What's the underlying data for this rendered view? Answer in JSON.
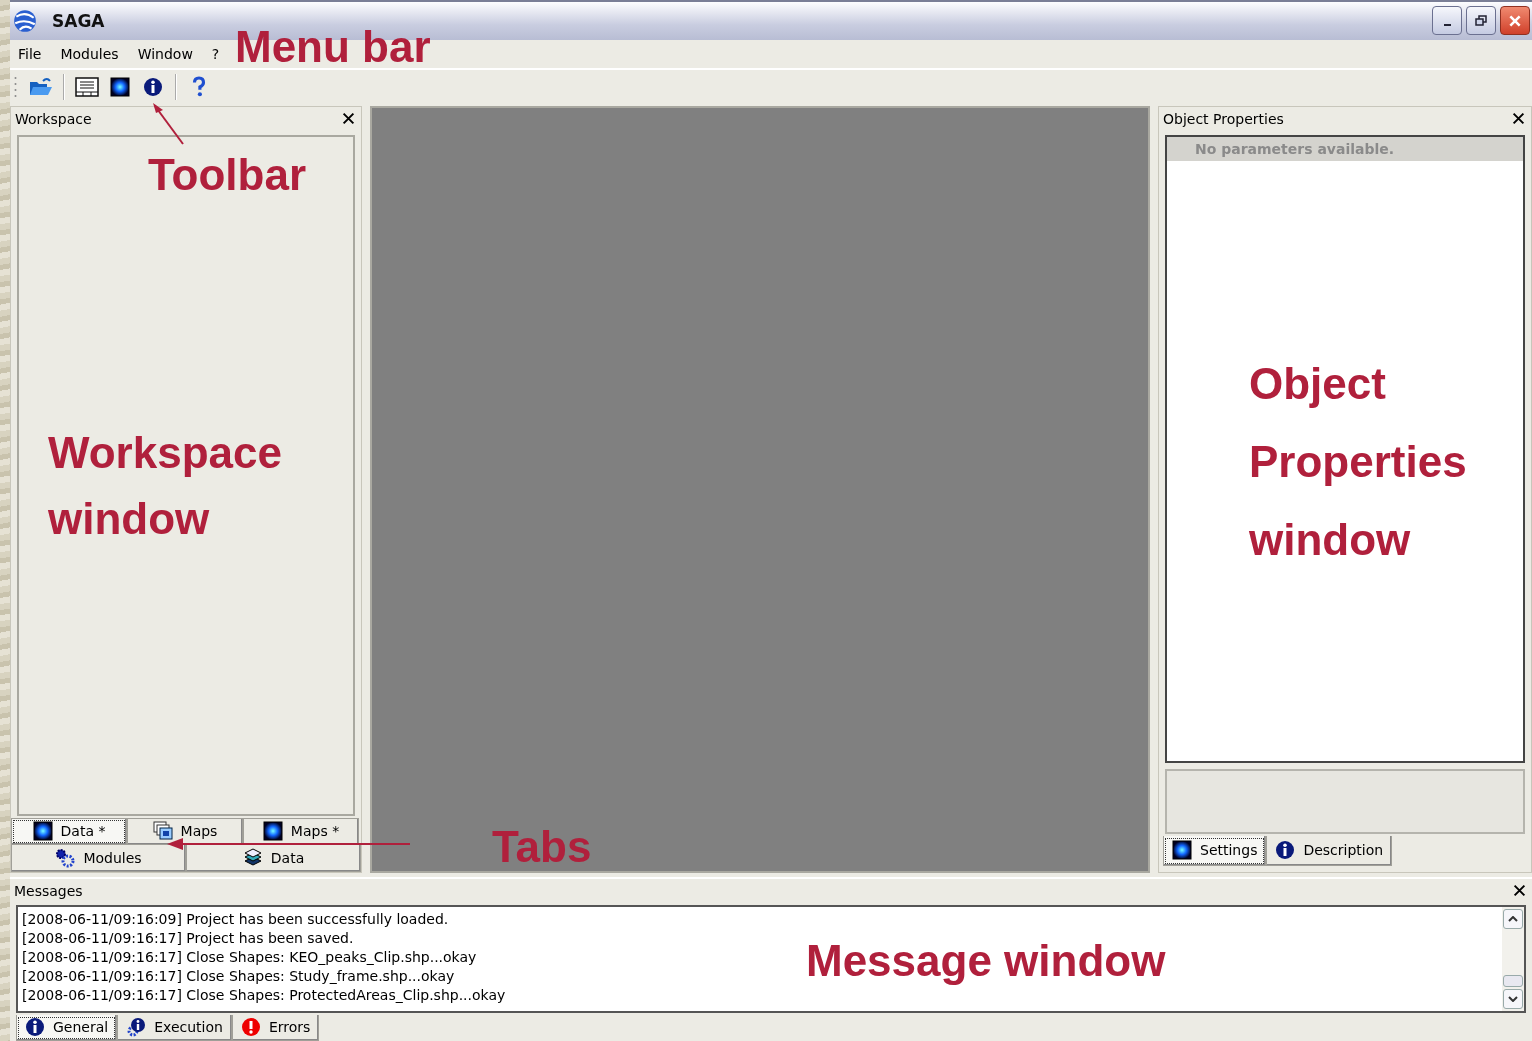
{
  "window": {
    "title": "SAGA"
  },
  "menu": [
    "File",
    "Modules",
    "Window",
    "?"
  ],
  "workspace": {
    "title": "Workspace",
    "tabs_row1": [
      {
        "label": "Data *",
        "kind": "grid",
        "selected": true
      },
      {
        "label": "Maps",
        "kind": "maps",
        "selected": false
      },
      {
        "label": "Maps *",
        "kind": "grid",
        "selected": false
      }
    ],
    "tabs_row2": [
      {
        "label": "Modules",
        "kind": "modules",
        "selected": false
      },
      {
        "label": "Data",
        "kind": "layers",
        "selected": false
      }
    ]
  },
  "object_properties": {
    "title": "Object Properties",
    "notice": "No parameters available.",
    "tabs": [
      {
        "label": "Settings",
        "kind": "grid",
        "selected": true
      },
      {
        "label": "Description",
        "kind": "info",
        "selected": false
      }
    ]
  },
  "messages": {
    "title": "Messages",
    "lines": [
      "[2008-06-11/09:16:09] Project has been successfully loaded.",
      "[2008-06-11/09:16:17] Project has been saved.",
      "[2008-06-11/09:16:17] Close Shapes: KEO_peaks_Clip.shp...okay",
      "[2008-06-11/09:16:17] Close Shapes: Study_frame.shp...okay",
      "[2008-06-11/09:16:17] Close Shapes: ProtectedAreas_Clip.shp...okay"
    ],
    "tabs": [
      {
        "label": "General",
        "kind": "info",
        "selected": true
      },
      {
        "label": "Execution",
        "kind": "execution",
        "selected": false
      },
      {
        "label": "Errors",
        "kind": "error",
        "selected": false
      }
    ]
  },
  "annotations": [
    {
      "kind": "menu",
      "lines": [
        "Menu bar"
      ]
    },
    {
      "kind": "toolbar",
      "lines": [
        "Toolbar"
      ]
    },
    {
      "kind": "workspace",
      "lines": [
        "Workspace",
        "window"
      ]
    },
    {
      "kind": "tabs",
      "lines": [
        "Tabs"
      ]
    },
    {
      "kind": "properties",
      "lines": [
        "Object",
        "Properties",
        "window"
      ]
    },
    {
      "kind": "messages",
      "lines": [
        "Message window"
      ]
    }
  ]
}
